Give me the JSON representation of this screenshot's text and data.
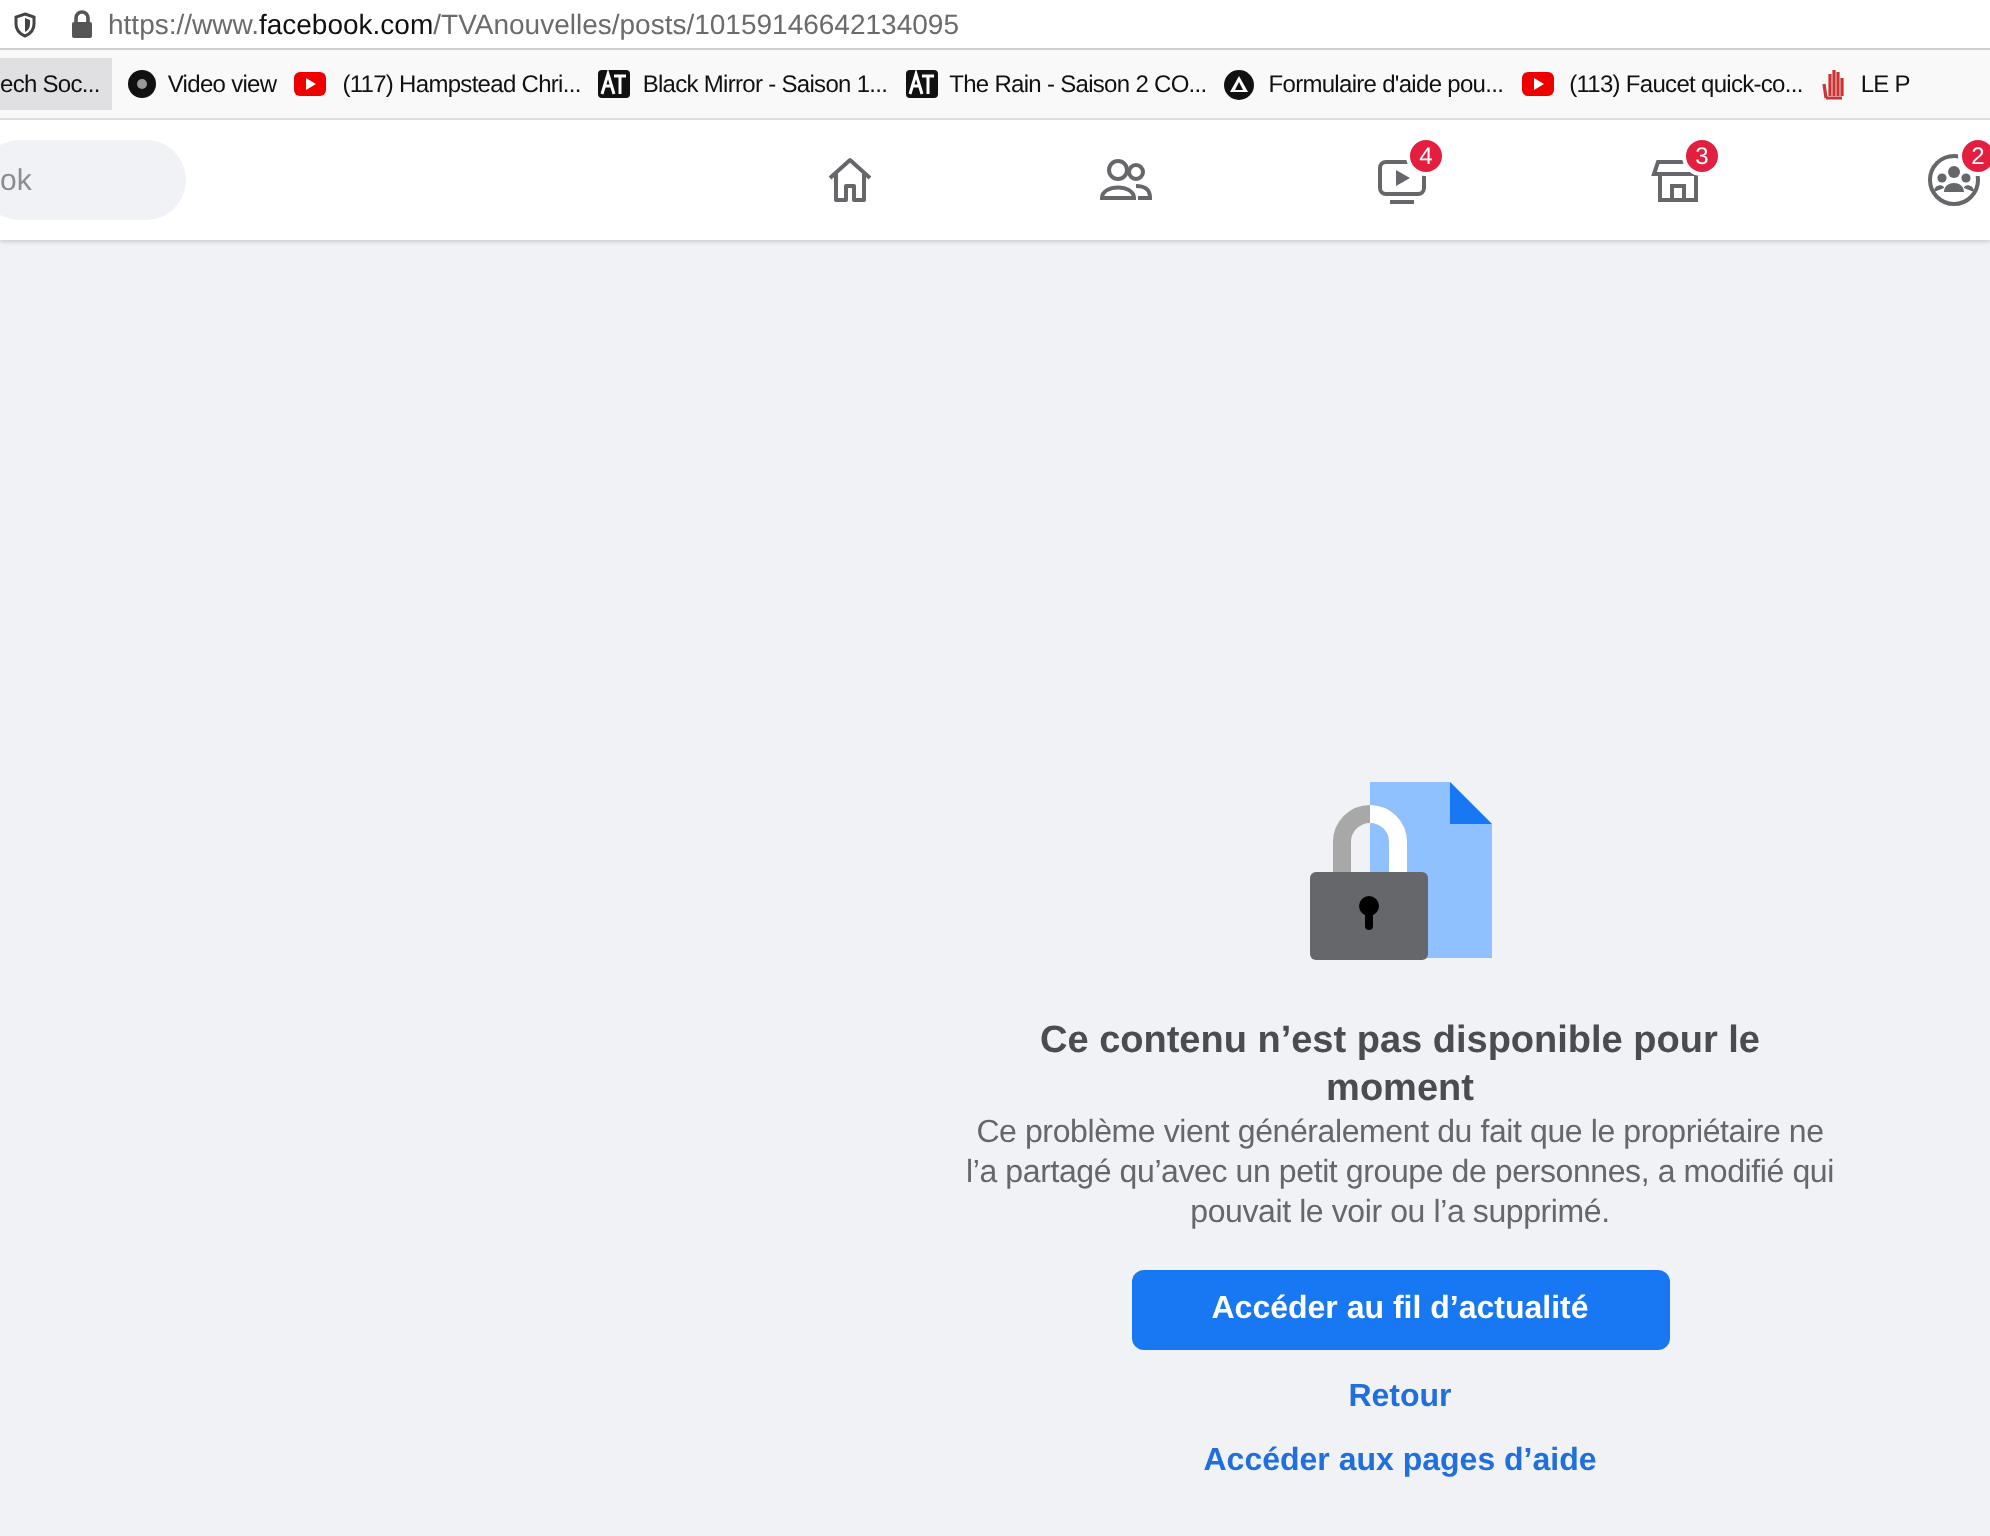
{
  "address_bar": {
    "scheme": "https://www.",
    "host": "facebook.com",
    "path": "/TVAnouvelles/posts/10159146642134095"
  },
  "bookmarks": [
    {
      "label": "ech Soc...",
      "selected": true
    },
    {
      "label": "Video view",
      "selected": false
    },
    {
      "label": "(117) Hampstead Chri...",
      "selected": false
    },
    {
      "label": "Black Mirror - Saison 1...",
      "selected": false
    },
    {
      "label": "The Rain - Saison 2 CO...",
      "selected": false
    },
    {
      "label": "Formulaire d'aide pou...",
      "selected": false
    },
    {
      "label": "(113) Faucet quick-co...",
      "selected": false
    },
    {
      "label": "LE P",
      "selected": false
    }
  ],
  "search": {
    "placeholder": "ok"
  },
  "nav": [
    {
      "kind": "home"
    },
    {
      "kind": "friends"
    },
    {
      "kind": "video",
      "badge": "4"
    },
    {
      "kind": "store",
      "badge": "3"
    },
    {
      "kind": "groups",
      "badge": "2"
    }
  ],
  "message": {
    "title": "Ce contenu n’est pas disponible pour le moment",
    "body": "Ce problème vient généralement du fait que le propriétaire ne l’a partagé qu’avec un petit groupe de personnes, a modifié qui pouvait le voir ou l’a supprimé.",
    "primary_button": "Accéder au fil d’actualité",
    "links": [
      "Retour",
      "Accéder aux pages d’aide"
    ]
  }
}
